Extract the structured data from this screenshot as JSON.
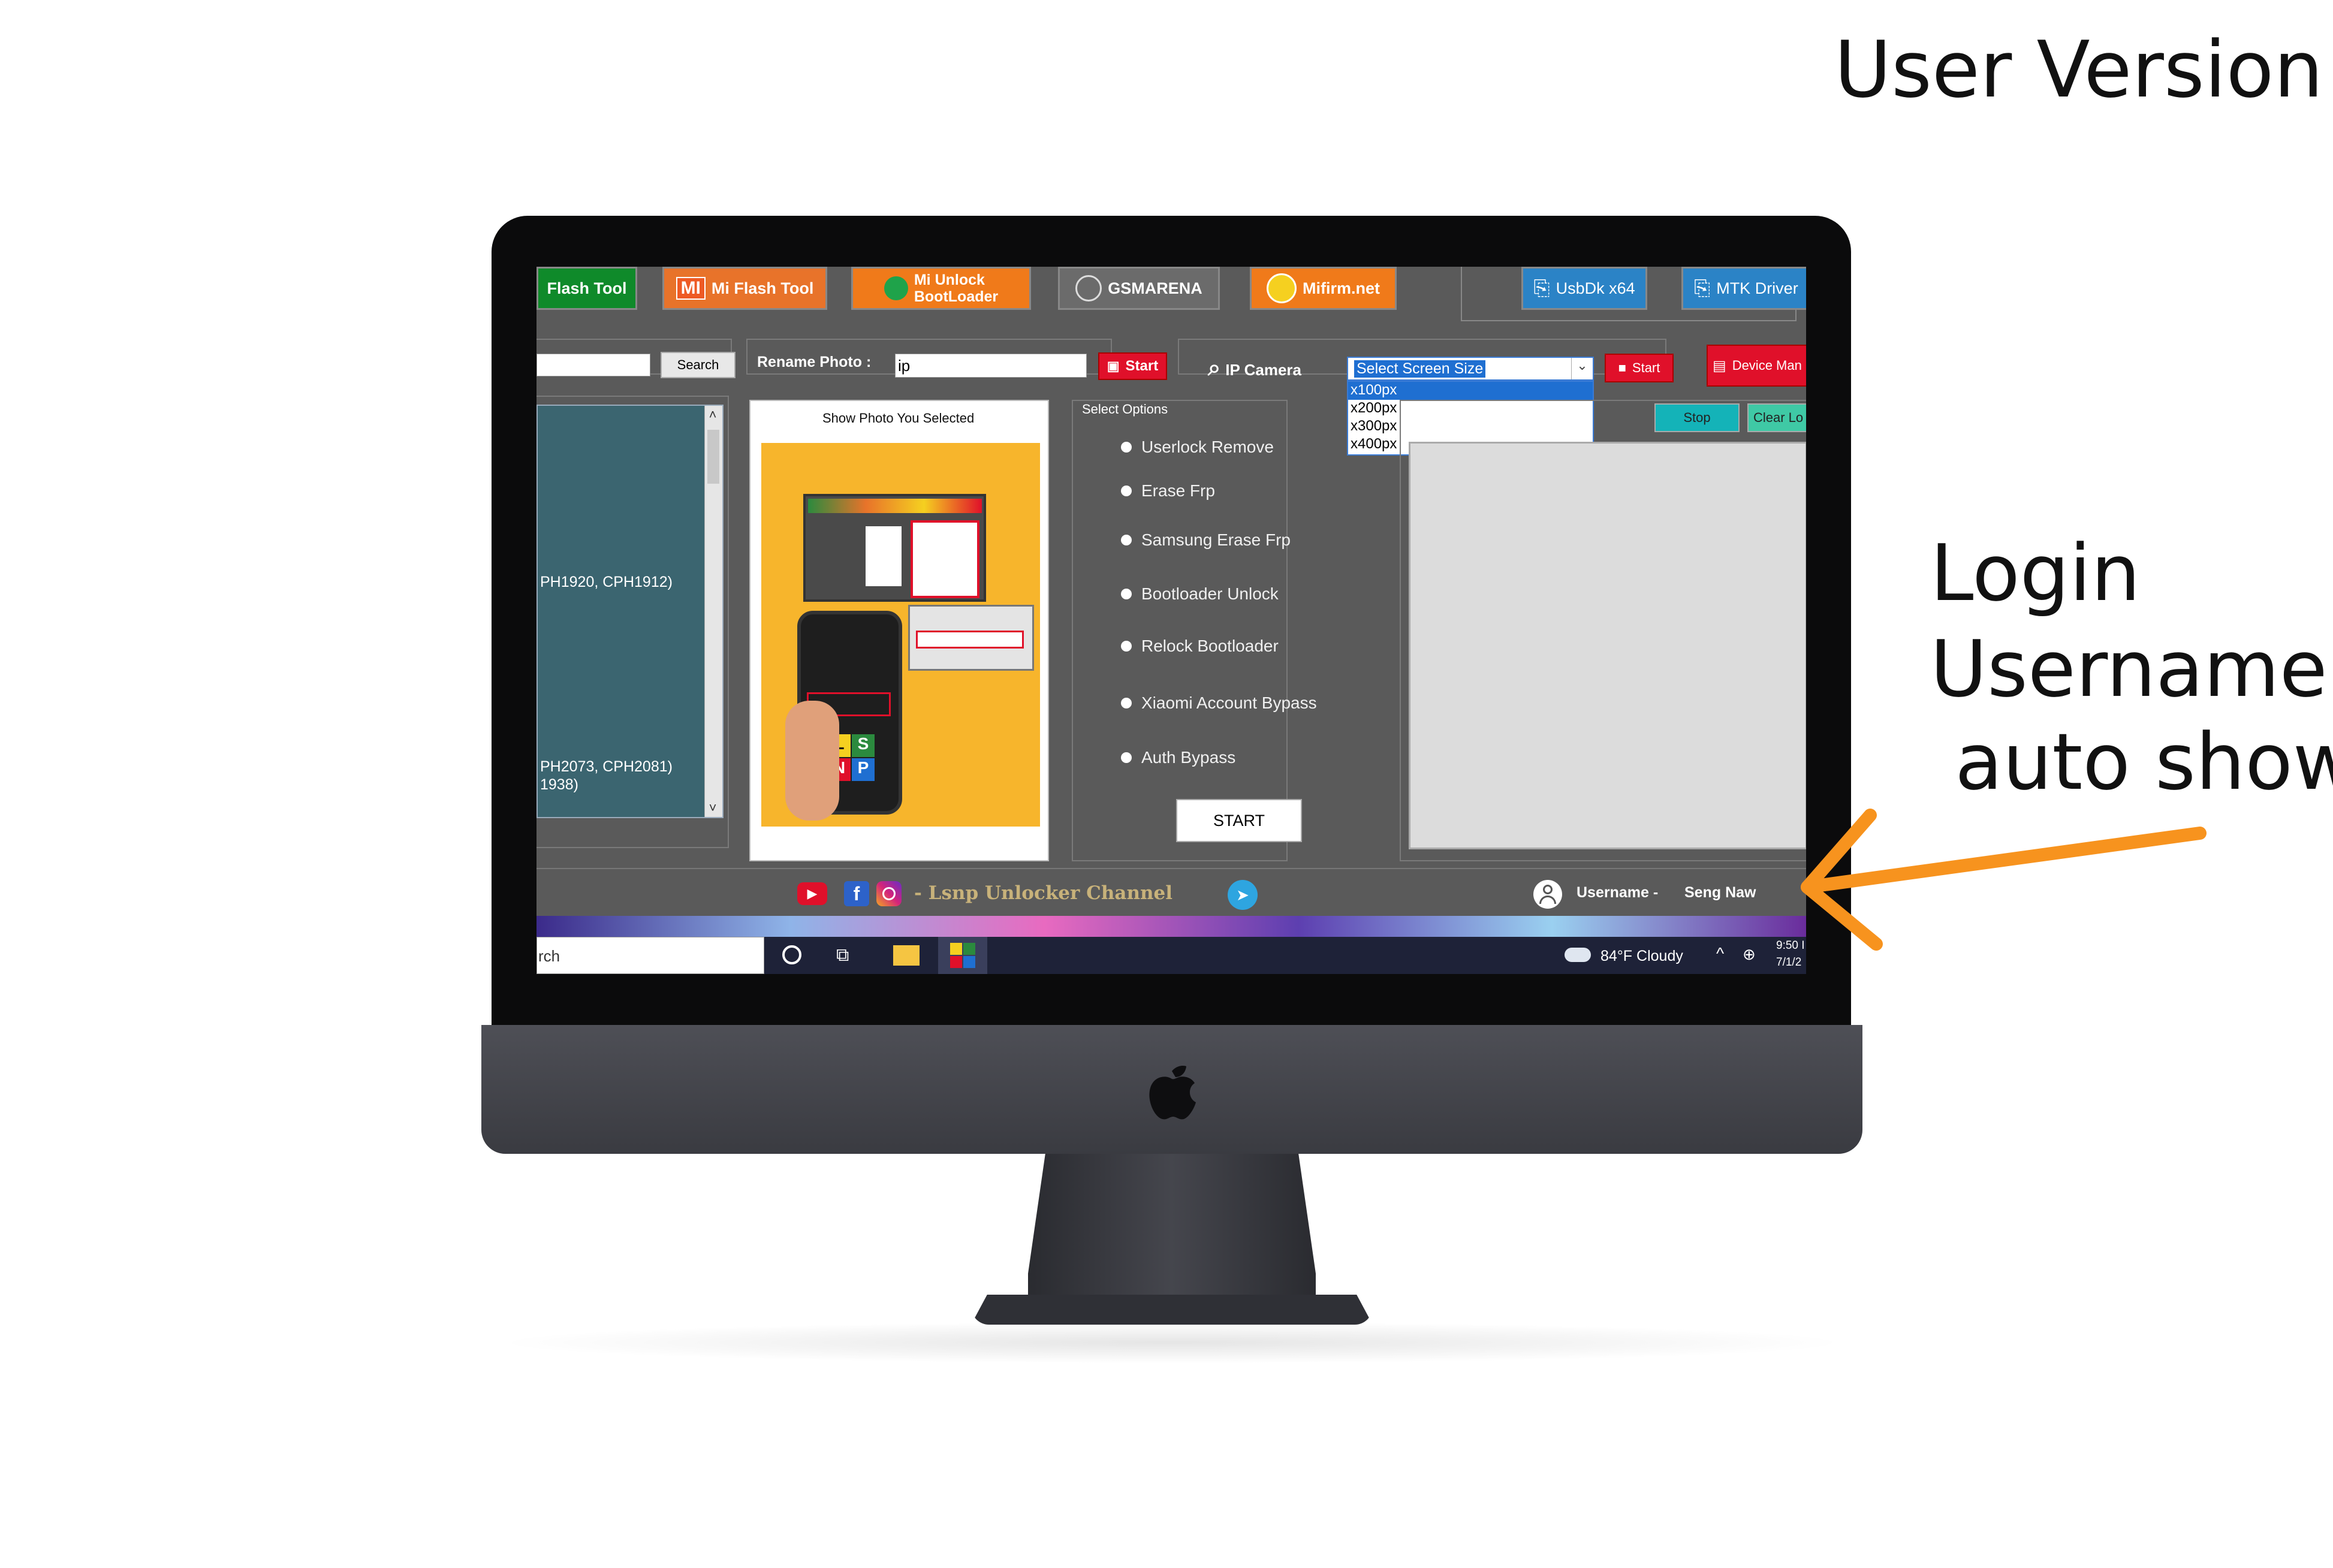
{
  "caption": {
    "title": "User Version",
    "side_lines": [
      "Login",
      "Username",
      " auto show"
    ],
    "arrow_color": "#F7931E"
  },
  "app": {
    "toolbar": {
      "flash_tool": "Flash Tool",
      "mi_flash_tool": "Mi Flash Tool",
      "mi_unlock_line1": "Mi Unlock",
      "mi_unlock_line2": "BootLoader",
      "gsmarena": "GSMARENA",
      "mifirm": "Mifirm.net",
      "usbdk": "UsbDk x64",
      "mtk_driver": "MTK Driver"
    },
    "search": {
      "value": "",
      "button": "Search"
    },
    "rename": {
      "label": "Rename Photo :",
      "value": "ip",
      "start": "Start"
    },
    "ip_camera": {
      "label": "IP Camera",
      "select_value": "Select Screen Size",
      "options": [
        "x100px",
        "x200px",
        "x300px",
        "x400px"
      ],
      "start": "Start",
      "device_manager": "Device Man"
    },
    "model_list": {
      "items": [
        "PH1920, CPH1912)",
        "PH2073, CPH2081)",
        "1938)"
      ]
    },
    "photo_panel": {
      "title": "Show Photo You Selected"
    },
    "options": {
      "group_label": "Select Options",
      "items": [
        "Userlock Remove",
        "Erase Frp",
        "Samsung Erase Frp",
        "Bootloader Unlock",
        "Relock Bootloader",
        "Xiaomi Account Bypass",
        "Auth Bypass"
      ],
      "start": "START"
    },
    "log": {
      "stop": "Stop",
      "clear": "Clear Lo"
    },
    "footer": {
      "channel": "- Lsnp Unlocker Channel",
      "username_label": "Username -",
      "username_value": "Seng Naw"
    },
    "taskbar": {
      "search_text": "rch",
      "weather": "84°F  Cloudy",
      "time": "9:50 I",
      "date": "7/1/2"
    },
    "colors": {
      "window_bg": "#5a5a5a",
      "list_bg": "#3b6570",
      "photo_bg": "#f7b52c",
      "red": "#e0102a",
      "teal": "#14b3b8"
    }
  }
}
